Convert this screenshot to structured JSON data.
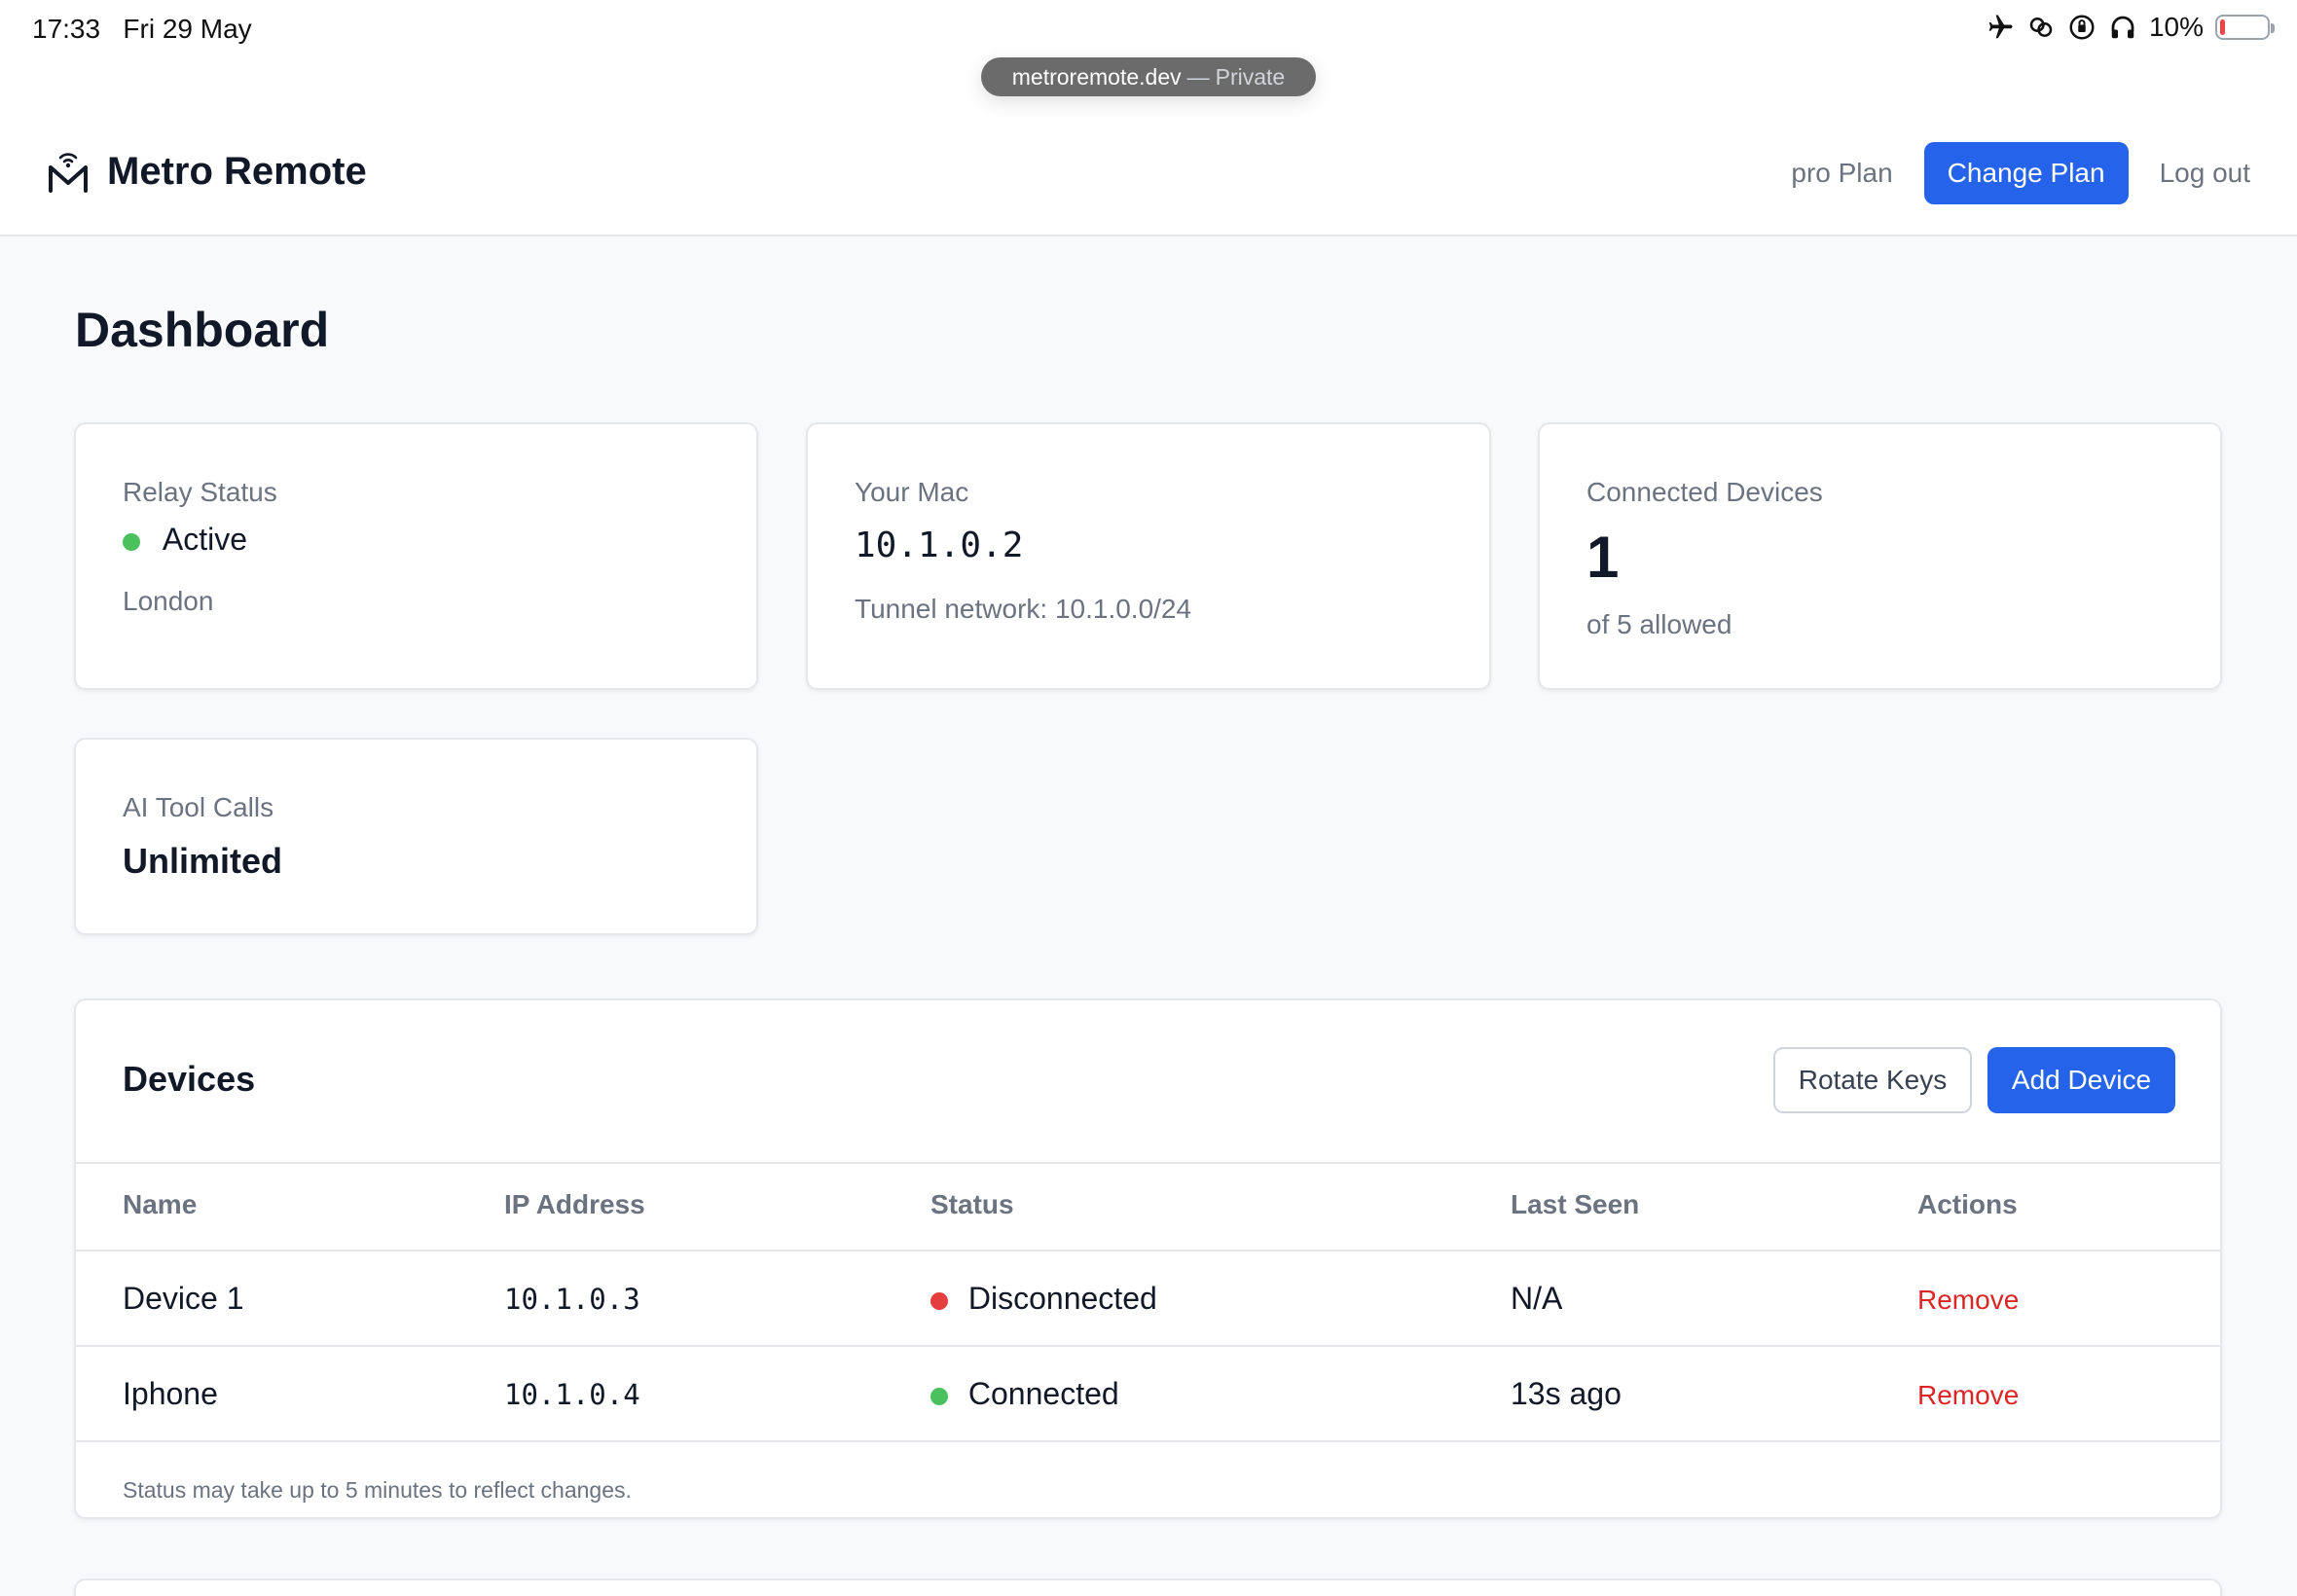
{
  "status_bar": {
    "time": "17:33",
    "date": "Fri 29 May",
    "battery": "10%",
    "battery_level": 0.1,
    "icons": [
      "airplane-icon",
      "link-icon",
      "orientation-lock-icon",
      "headphones-icon"
    ]
  },
  "url_bar": {
    "domain": "metroremote.dev",
    "separator": "—",
    "mode": "Private"
  },
  "header": {
    "brand": "Metro Remote",
    "plan": "pro Plan",
    "change_plan": "Change Plan",
    "logout": "Log out"
  },
  "page": {
    "title": "Dashboard"
  },
  "cards": {
    "relay": {
      "label": "Relay Status",
      "status": "Active",
      "location": "London"
    },
    "mac": {
      "label": "Your Mac",
      "ip": "10.1.0.2",
      "network": "Tunnel network: 10.1.0.0/24"
    },
    "connected": {
      "label": "Connected Devices",
      "count": "1",
      "allowed": "of 5 allowed"
    },
    "ai": {
      "label": "AI Tool Calls",
      "value": "Unlimited"
    }
  },
  "devices": {
    "title": "Devices",
    "rotate_keys": "Rotate Keys",
    "add_device": "Add Device",
    "columns": [
      "Name",
      "IP Address",
      "Status",
      "Last Seen",
      "Actions"
    ],
    "rows": [
      {
        "name": "Device 1",
        "ip": "10.1.0.3",
        "status": "Disconnected",
        "last_seen": "N/A",
        "action": "Remove"
      },
      {
        "name": "Iphone",
        "ip": "10.1.0.4",
        "status": "Connected",
        "last_seen": "13s ago",
        "action": "Remove"
      }
    ],
    "footnote": "Status may take up to 5 minutes to reflect changes."
  },
  "colors": {
    "accent": "#2563eb",
    "active": "#4bc15d",
    "disconnected": "#e53e3e",
    "remove": "#dc2626"
  }
}
